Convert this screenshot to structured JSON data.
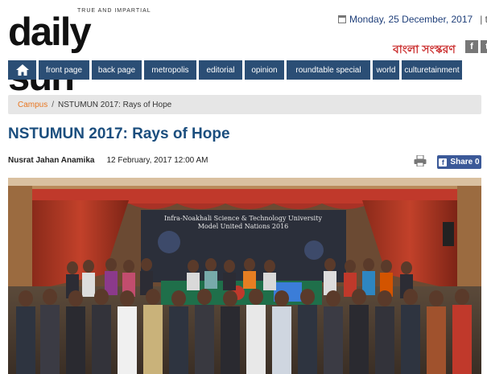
{
  "header": {
    "logo_tagline": "TRUE AND IMPARTIAL",
    "logo_text": "daily sun",
    "date": "Monday, 25 December, 2017",
    "separator": "| to",
    "bangla_edition": "বাংলা সংস্করণ",
    "social": [
      "f",
      "t"
    ]
  },
  "nav": {
    "items": [
      "front page",
      "back page",
      "metropolis",
      "editorial",
      "opinion",
      "roundtable special",
      "world",
      "culturetainment"
    ]
  },
  "breadcrumb": {
    "section": "Campus",
    "current": "NSTUMUN 2017: Rays of Hope"
  },
  "article": {
    "title": "NSTUMUN 2017: Rays of Hope",
    "author": "Nusrat Jahan Anamika",
    "published": "12 February, 2017 12:00 AM",
    "share_label": "Share 0",
    "photo_banner_line1": "Infra-Noakhali Science & Technology University",
    "photo_banner_line2": "Model United Nations 2016"
  }
}
